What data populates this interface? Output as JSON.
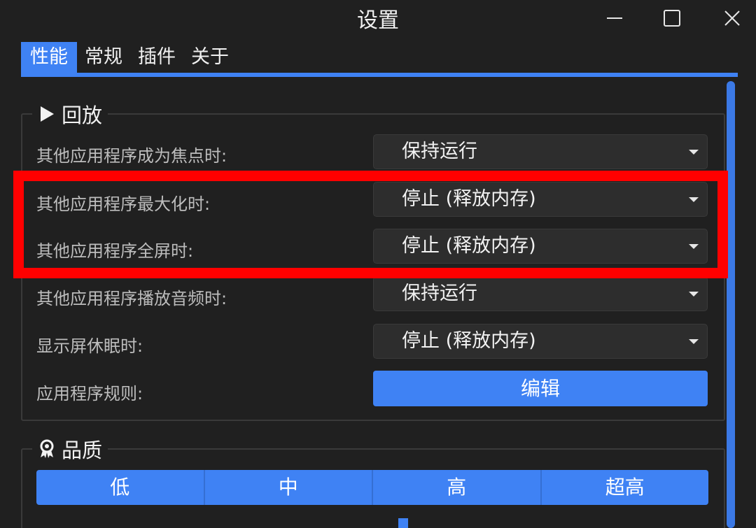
{
  "window": {
    "title": "设置",
    "controls": [
      "minimize-icon",
      "maximize-icon",
      "close-icon"
    ]
  },
  "tabs": [
    {
      "label": "性能",
      "active": true
    },
    {
      "label": "常规",
      "active": false
    },
    {
      "label": "插件",
      "active": false
    },
    {
      "label": "关于",
      "active": false
    }
  ],
  "playback": {
    "title": "回放",
    "icon": "play-icon",
    "rows": [
      {
        "label": "其他应用程序成为焦点时:",
        "value": "保持运行"
      },
      {
        "label": "其他应用程序最大化时:",
        "value": "停止 (释放内存)"
      },
      {
        "label": "其他应用程序全屏时:",
        "value": "停止 (释放内存)"
      },
      {
        "label": "其他应用程序播放音频时:",
        "value": "保持运行"
      },
      {
        "label": "显示屏休眠时:",
        "value": "停止 (释放内存)"
      }
    ],
    "rules_label": "应用程序规则:",
    "rules_button": "编辑"
  },
  "quality": {
    "title": "品质",
    "icon": "award-icon",
    "options": [
      "低",
      "中",
      "高",
      "超高"
    ]
  },
  "colors": {
    "accent": "#3f82f4",
    "background": "#202020",
    "highlight": "#ff0000"
  }
}
